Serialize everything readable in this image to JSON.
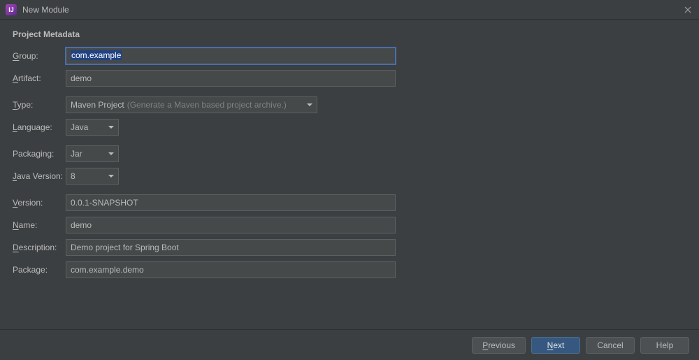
{
  "window": {
    "title": "New Module"
  },
  "section": {
    "title": "Project Metadata"
  },
  "labels": {
    "group": "roup:",
    "artifact": "rtifact:",
    "type": "ype:",
    "language": "anguage:",
    "packaging": "Packaging:",
    "javaVersion": "ava Version:",
    "version": "ersion:",
    "name": "ame:",
    "description": "escription:",
    "package": "Package:"
  },
  "values": {
    "group": "com.example",
    "artifact": "demo",
    "type": "Maven Project",
    "typeHint": "(Generate a Maven based project archive.)",
    "language": "Java",
    "packaging": "Jar",
    "javaVersion": "8",
    "version": "0.0.1-SNAPSHOT",
    "name": "demo",
    "description": "Demo project for Spring Boot",
    "package": "com.example.demo"
  },
  "buttons": {
    "previous": "revious",
    "next": "ext",
    "cancel": "Cancel",
    "help": "Help"
  }
}
